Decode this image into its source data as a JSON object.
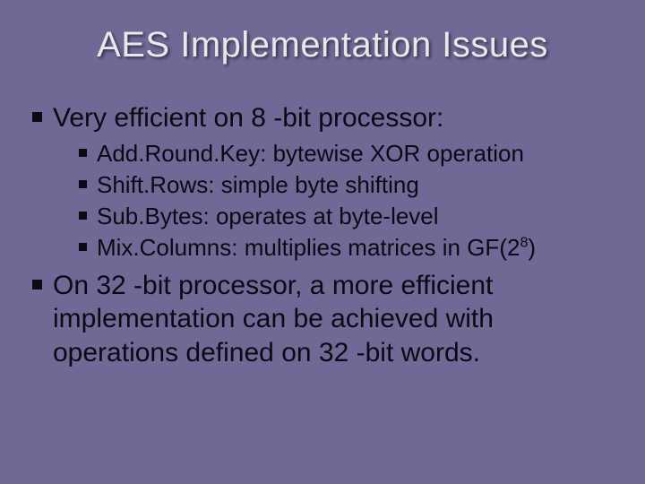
{
  "title": "AES Implementation Issues",
  "bullets": {
    "b1": "Very efficient on 8 -bit processor:",
    "sub1": "Add.Round.Key: bytewise XOR operation",
    "sub2": "Shift.Rows: simple byte shifting",
    "sub3": "Sub.Bytes: operates at byte-level",
    "sub4_pre": "Mix.Columns: multiplies matrices in GF(2",
    "sub4_sup": "8",
    "sub4_post": ")",
    "b2": "On 32 -bit processor, a more efficient implementation can be achieved with operations defined on 32 -bit words."
  }
}
